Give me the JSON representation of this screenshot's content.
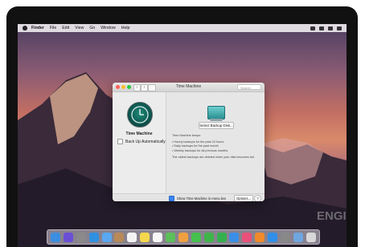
{
  "menubar": {
    "items": [
      "Finder",
      "File",
      "Edit",
      "View",
      "Go",
      "Window",
      "Help"
    ]
  },
  "window": {
    "title": "Time Machine",
    "search_placeholder": "Search",
    "nav_back": "‹",
    "nav_forward": "›",
    "left": {
      "app_name": "Time Machine",
      "backup_auto_label": "Back Up Automatically"
    },
    "right": {
      "select_button": "Select Backup Disk...",
      "info_heading": "Time Machine keeps:",
      "info_items": [
        "• Hourly backups for the past 24 hours",
        "• Daily backups for the past month",
        "• Weekly backups for all previous months"
      ],
      "info_footer": "The oldest backups are deleted when your disk becomes full."
    },
    "bottom": {
      "show_menu_bar_label": "Show Time Machine in menu bar",
      "show_menu_bar_checked": true,
      "options_button": "Options...",
      "help_button": "?"
    }
  },
  "dock": {
    "icons": [
      {
        "name": "finder-icon",
        "color": "#3b8ee0"
      },
      {
        "name": "siri-icon",
        "color": "#6a4fd6"
      },
      {
        "name": "launchpad-icon",
        "color": "#8a8a8a"
      },
      {
        "name": "safari-icon",
        "color": "#2f8fe0"
      },
      {
        "name": "mail-icon",
        "color": "#5aa8f0"
      },
      {
        "name": "contacts-icon",
        "color": "#b88a58"
      },
      {
        "name": "calendar-icon",
        "color": "#f4f4f4"
      },
      {
        "name": "notes-icon",
        "color": "#f5d74e"
      },
      {
        "name": "reminders-icon",
        "color": "#f7f7f7"
      },
      {
        "name": "maps-icon",
        "color": "#5cbf5a"
      },
      {
        "name": "photos-icon",
        "color": "#f0a040"
      },
      {
        "name": "messages-icon",
        "color": "#46c04f"
      },
      {
        "name": "facetime-icon",
        "color": "#3fb54a"
      },
      {
        "name": "numbers-icon",
        "color": "#35b04e"
      },
      {
        "name": "keynote-icon",
        "color": "#3a8ee8"
      },
      {
        "name": "itunes-icon",
        "color": "#e9507a"
      },
      {
        "name": "ibooks-icon",
        "color": "#f08a2a"
      },
      {
        "name": "app-store-icon",
        "color": "#2f8fe8"
      },
      {
        "name": "system-preferences-icon",
        "color": "#888888"
      },
      {
        "name": "downloads-icon",
        "color": "#6fa6e0"
      },
      {
        "name": "trash-icon",
        "color": "#d8d8d8"
      }
    ]
  }
}
